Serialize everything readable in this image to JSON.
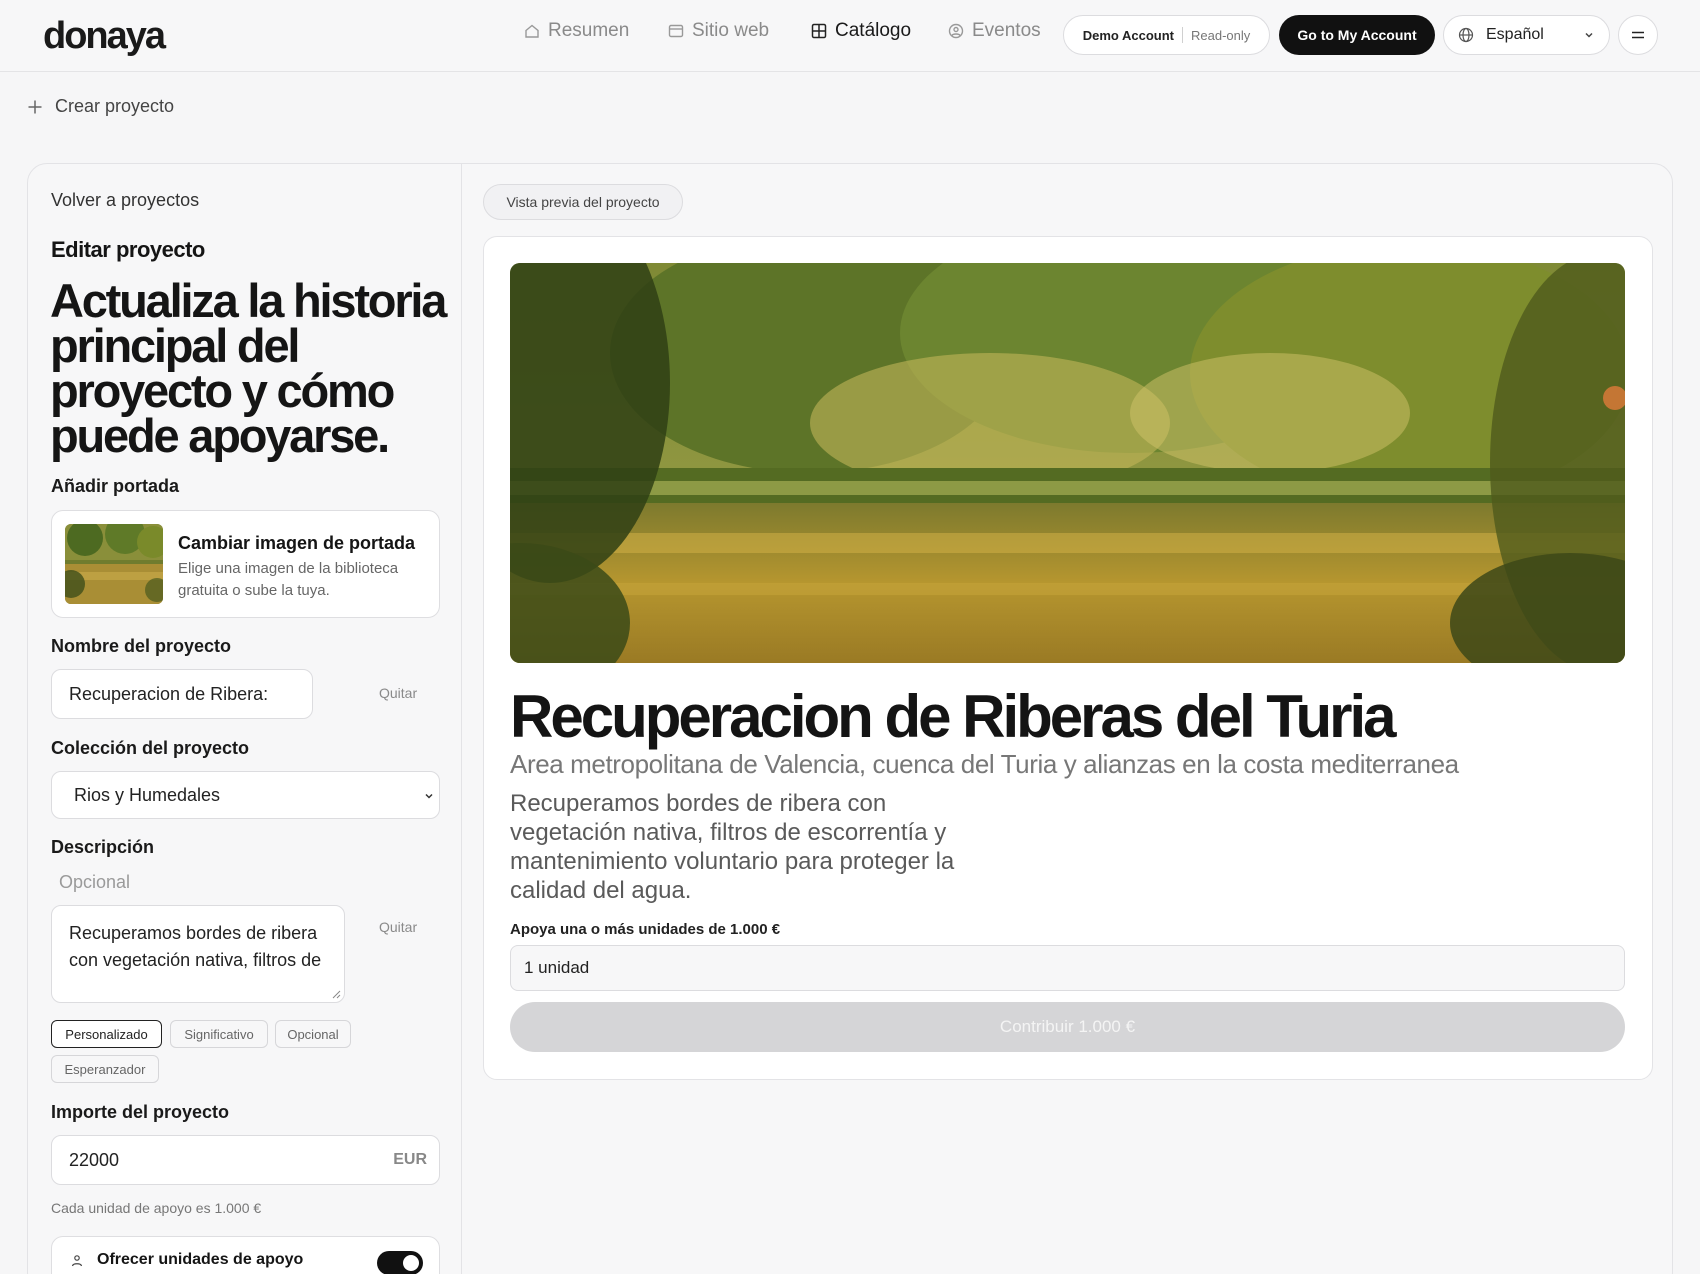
{
  "app": {
    "logo": "donaya"
  },
  "nav": [
    {
      "label": "Resumen",
      "icon": "home-icon"
    },
    {
      "label": "Sitio web",
      "icon": "browser-icon"
    },
    {
      "label": "Catálogo",
      "icon": "grid-icon",
      "active": true
    },
    {
      "label": "Eventos",
      "icon": "user-circle-icon"
    }
  ],
  "header": {
    "demo_account": "Demo Account",
    "read_only": "Read-only",
    "go_account": "Go to My Account",
    "language": "Español"
  },
  "toolbar": {
    "create": "Crear proyecto"
  },
  "editor": {
    "back": "Volver a proyectos",
    "title": "Editar proyecto",
    "headline": "Actualiza la historia principal del proyecto y cómo puede apoyarse.",
    "cover_label": "Añadir portada",
    "cover_title": "Cambiar imagen de portada",
    "cover_desc": "Elige una imagen de la biblioteca gratuita o sube la tuya.",
    "name_label": "Nombre del proyecto",
    "name_value": "Recuperacion de Ribera:",
    "remove": "Quitar",
    "collection_label": "Colección del proyecto",
    "collection_value": "Rios y Humedales",
    "desc_label": "Descripción",
    "desc_placeholder": "Opcional",
    "desc_value": "Recuperamos bordes de ribera con vegetación nativa, filtros de",
    "tones": [
      "Personalizado",
      "Significativo",
      "Opcional",
      "Esperanzador"
    ],
    "amount_label": "Importe del proyecto",
    "amount_value": "22000",
    "currency": "EUR",
    "unit_hint": "Cada unidad de apoyo es 1.000 €",
    "offer_units": "Ofrecer unidades de apoyo",
    "offer_enabled": true
  },
  "preview": {
    "pill": "Vista previa del proyecto",
    "title": "Recuperacion de Riberas del Turia",
    "subtitle": "Area metropolitana de Valencia, cuenca del Turia y alianzas en la costa mediterranea",
    "description": "Recuperamos bordes de ribera con vegetación nativa, filtros de escorrentía y mantenimiento voluntario para proteger la calidad del agua.",
    "units_label": "Apoya una o más unidades de 1.000 €",
    "units_value": "1 unidad",
    "contribute": "Contribuir 1.000 €"
  }
}
